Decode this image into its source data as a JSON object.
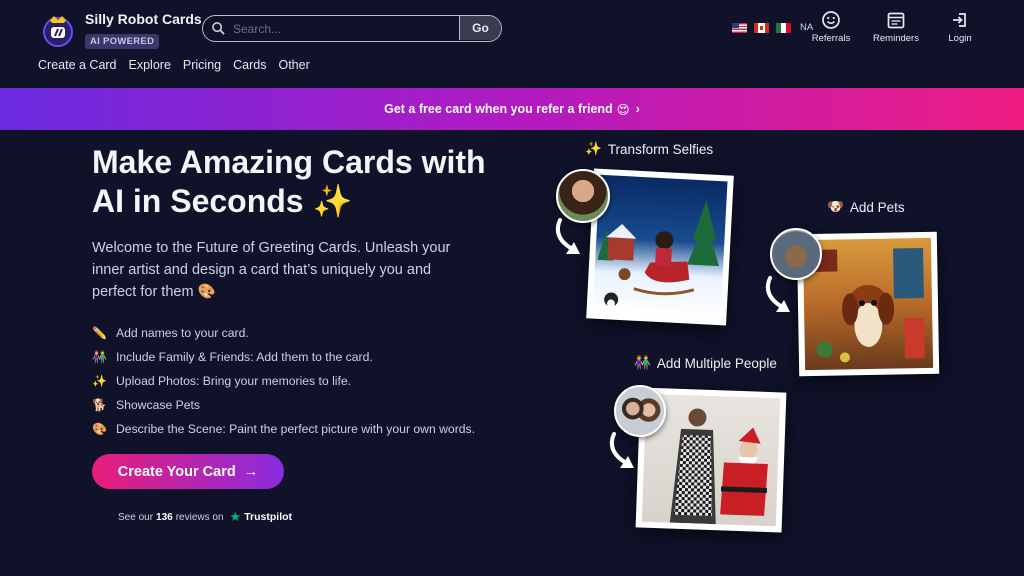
{
  "brand": {
    "name": "Silly Robot Cards",
    "badge": "AI POWERED"
  },
  "search": {
    "placeholder": "Search...",
    "go_label": "Go"
  },
  "nav": [
    "Create a Card",
    "Explore",
    "Pricing",
    "Cards",
    "Other"
  ],
  "locale": {
    "label": "NA",
    "flags": [
      "us-flag-icon",
      "canada-flag-icon",
      "mexico-flag-icon"
    ]
  },
  "top_actions": {
    "referrals": "Referrals",
    "reminders": "Reminders",
    "login": "Login"
  },
  "banner": {
    "text": "Get a free card when you refer a friend",
    "emoji": "😍",
    "chevron": "›"
  },
  "hero": {
    "title_line1": "Make Amazing Cards with",
    "title_line2": "AI in Seconds",
    "title_emoji": "✨",
    "subtitle": "Welcome to the Future of Greeting Cards. Unleash your inner artist and design a card that’s uniquely you and perfect for them",
    "subtitle_emoji": "🎨",
    "features": [
      {
        "icon": "✏️",
        "text": "Add names to your card."
      },
      {
        "icon": "👫",
        "text": "Include Family & Friends: Add them to the card."
      },
      {
        "icon": "✨",
        "text": "Upload Photos: Bring your memories to life."
      },
      {
        "icon": "🐕",
        "text": "Showcase Pets"
      },
      {
        "icon": "🎨",
        "text": "Describe the Scene: Paint the perfect picture with your own words."
      }
    ],
    "cta_label": "Create Your Card",
    "cta_arrow": "→",
    "reviews": {
      "prefix": "See our",
      "count": "136",
      "suffix": "reviews on",
      "platform": "Trustpilot",
      "star": "★"
    }
  },
  "showcase": {
    "selfies": {
      "icon": "✨",
      "label": "Transform Selfies"
    },
    "pets": {
      "icon": "🐶",
      "label": "Add Pets"
    },
    "people": {
      "icon": "👫",
      "label": "Add Multiple People"
    }
  },
  "colors": {
    "background": "#0f1229",
    "banner_start": "#6a2be0",
    "banner_end": "#ef1d82",
    "cta_start": "#e81d78",
    "cta_end": "#8a2cde",
    "trustpilot": "#00b67a"
  }
}
